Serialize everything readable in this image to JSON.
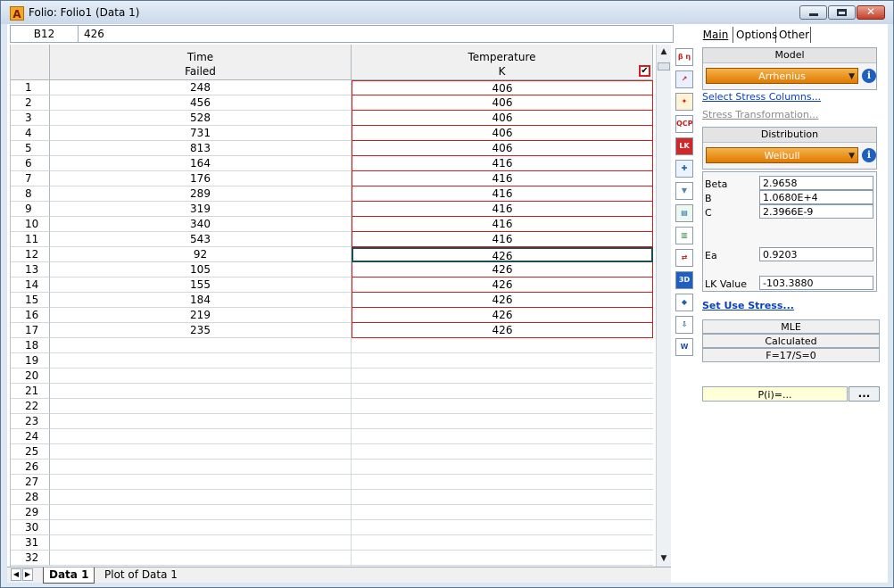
{
  "window": {
    "title": "Folio: Folio1 (Data 1)",
    "app_icon": "A"
  },
  "formula_bar": {
    "cell_ref": "B12",
    "cell_value": "426"
  },
  "grid": {
    "headers": [
      {
        "line1": "Time",
        "line2": "Failed"
      },
      {
        "line1": "Temperature",
        "line2": "K"
      }
    ],
    "header_check": "✔",
    "rows": [
      {
        "n": "1",
        "time": "248",
        "temp": "406"
      },
      {
        "n": "2",
        "time": "456",
        "temp": "406"
      },
      {
        "n": "3",
        "time": "528",
        "temp": "406"
      },
      {
        "n": "4",
        "time": "731",
        "temp": "406"
      },
      {
        "n": "5",
        "time": "813",
        "temp": "406"
      },
      {
        "n": "6",
        "time": "164",
        "temp": "416"
      },
      {
        "n": "7",
        "time": "176",
        "temp": "416"
      },
      {
        "n": "8",
        "time": "289",
        "temp": "416"
      },
      {
        "n": "9",
        "time": "319",
        "temp": "416"
      },
      {
        "n": "10",
        "time": "340",
        "temp": "416"
      },
      {
        "n": "11",
        "time": "543",
        "temp": "416"
      },
      {
        "n": "12",
        "time": "92",
        "temp": "426"
      },
      {
        "n": "13",
        "time": "105",
        "temp": "426"
      },
      {
        "n": "14",
        "time": "155",
        "temp": "426"
      },
      {
        "n": "15",
        "time": "184",
        "temp": "426"
      },
      {
        "n": "16",
        "time": "219",
        "temp": "426"
      },
      {
        "n": "17",
        "time": "235",
        "temp": "426"
      },
      {
        "n": "18",
        "time": "",
        "temp": ""
      },
      {
        "n": "19",
        "time": "",
        "temp": ""
      },
      {
        "n": "20",
        "time": "",
        "temp": ""
      },
      {
        "n": "21",
        "time": "",
        "temp": ""
      },
      {
        "n": "22",
        "time": "",
        "temp": ""
      },
      {
        "n": "23",
        "time": "",
        "temp": ""
      },
      {
        "n": "24",
        "time": "",
        "temp": ""
      },
      {
        "n": "25",
        "time": "",
        "temp": ""
      },
      {
        "n": "26",
        "time": "",
        "temp": ""
      },
      {
        "n": "27",
        "time": "",
        "temp": ""
      },
      {
        "n": "28",
        "time": "",
        "temp": ""
      },
      {
        "n": "29",
        "time": "",
        "temp": ""
      },
      {
        "n": "30",
        "time": "",
        "temp": ""
      },
      {
        "n": "31",
        "time": "",
        "temp": ""
      },
      {
        "n": "32",
        "time": "",
        "temp": ""
      }
    ]
  },
  "sheet_tabs": [
    "Data 1",
    "Plot of Data 1"
  ],
  "toolbar_icons": [
    {
      "name": "calculate-icon",
      "glyph": "β η σ μ",
      "color": "#c62020",
      "bg": "#fff"
    },
    {
      "name": "plot-icon",
      "glyph": "↗",
      "color": "#c62020",
      "bg": "#eaf0ff"
    },
    {
      "name": "wizard-icon",
      "glyph": "✦",
      "color": "#c62020",
      "bg": "#fff3d6"
    },
    {
      "name": "qcp-icon",
      "glyph": "QCP",
      "color": "#c62020",
      "bg": "#fff"
    },
    {
      "name": "lk-icon",
      "glyph": "LK",
      "color": "#fff",
      "bg": "#d02828"
    },
    {
      "name": "contour-plot-icon",
      "glyph": "✚",
      "color": "#1f5fa8",
      "bg": "#eaf3ff"
    },
    {
      "name": "filter-icon",
      "glyph": "▼",
      "color": "#5b86a8",
      "bg": "#fff"
    },
    {
      "name": "transfer-icon",
      "glyph": "▤",
      "color": "#1f6aa8",
      "bg": "#eef8ee"
    },
    {
      "name": "batch-icon",
      "glyph": "▥",
      "color": "#2e8b3a",
      "bg": "#fff"
    },
    {
      "name": "compare-icon",
      "glyph": "⇄",
      "color": "#c62020",
      "bg": "#fff"
    },
    {
      "name": "3d-plot-icon",
      "glyph": "3D",
      "color": "#fff",
      "bg": "#1f5fbf"
    },
    {
      "name": "tag-icon",
      "glyph": "◆",
      "color": "#1f5fa8",
      "bg": "#fff"
    },
    {
      "name": "export-icon",
      "glyph": "⇩",
      "color": "#1f5fa8",
      "bg": "#fff"
    },
    {
      "name": "word-report-icon",
      "glyph": "W",
      "color": "#1f4fb0",
      "bg": "#fff"
    }
  ],
  "panel": {
    "tabs": [
      "Main",
      "Options",
      "Other"
    ],
    "model": {
      "header": "Model",
      "value": "Arrhenius"
    },
    "links": {
      "select_stress": "Select Stress Columns...",
      "stress_transform": "Stress Transformation...",
      "set_use_stress": "Set Use Stress..."
    },
    "distribution": {
      "header": "Distribution",
      "value": "Weibull"
    },
    "params": [
      {
        "label": "Beta",
        "value": "2.9658"
      },
      {
        "label": "B",
        "value": "1.0680E+4"
      },
      {
        "label": "C",
        "value": "2.3966E-9"
      },
      {
        "label": "Ea",
        "value": "0.9203"
      },
      {
        "label": "LK Value",
        "value": "-103.3880"
      }
    ],
    "status": [
      "MLE",
      "Calculated",
      "F=17/S=0"
    ],
    "pi_text": "P(i)=...",
    "more_button": "..."
  },
  "colors": {
    "accent_orange": "#e58a0c",
    "link_blue": "#0a3fb8",
    "selected_border": "#1d4f50",
    "red_border": "#cc2020"
  }
}
